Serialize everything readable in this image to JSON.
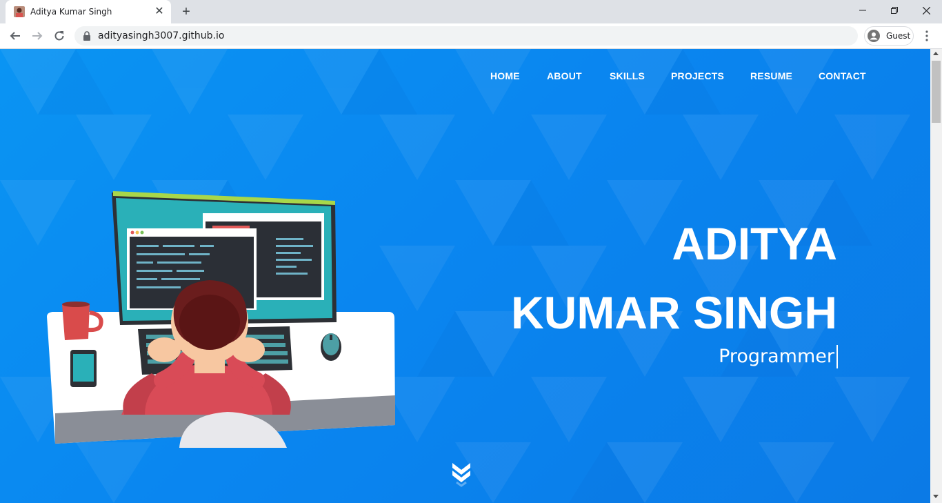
{
  "browser": {
    "tab_title": "Aditya Kumar Singh",
    "tab_close": "✕",
    "new_tab": "+",
    "url": "adityasingh3007.github.io",
    "profile_label": "Guest"
  },
  "site": {
    "nav": [
      "HOME",
      "ABOUT",
      "SKILLS",
      "PROJECTS",
      "RESUME",
      "CONTACT"
    ],
    "name_line_1": "ADITYA",
    "name_line_2": "KUMAR SINGH",
    "role": "Programmer"
  },
  "colors": {
    "hero_bg": "#0a86f0",
    "text": "#ffffff",
    "chrome_bg": "#dee1e6"
  },
  "icons": [
    "favicon",
    "close-icon",
    "plus-icon",
    "minimize-icon",
    "maximize-icon",
    "window-close-icon",
    "back-arrow-icon",
    "forward-arrow-icon",
    "reload-icon",
    "lock-icon",
    "avatar-icon",
    "more-vert-icon",
    "chevron-double-down-icon"
  ]
}
